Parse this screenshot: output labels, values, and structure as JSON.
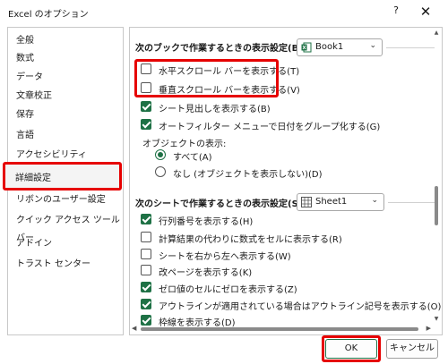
{
  "window": {
    "title": "Excel のオプション",
    "help_label": "?",
    "close_label": "✕"
  },
  "sidebar": {
    "items": [
      {
        "label": "全般"
      },
      {
        "label": "数式"
      },
      {
        "label": "データ"
      },
      {
        "label": "文章校正"
      },
      {
        "label": "保存"
      },
      {
        "label": "言語"
      },
      {
        "label": "アクセシビリティ"
      },
      {
        "label": "詳細設定",
        "selected": true
      },
      {
        "label": "リボンのユーザー設定"
      },
      {
        "label": "クイック アクセス ツール バー"
      },
      {
        "label": "アドイン"
      },
      {
        "label": "トラスト センター"
      }
    ]
  },
  "workbook_section": {
    "header": "次のブックで作業するときの表示設定(B):",
    "combo_value": "Book1",
    "options": [
      {
        "label": "水平スクロール バーを表示する(T)",
        "checked": false
      },
      {
        "label": "垂直スクロール バーを表示する(V)",
        "checked": false
      },
      {
        "label": "シート見出しを表示する(B)",
        "checked": true
      },
      {
        "label": "オートフィルター メニューで日付をグループ化する(G)",
        "checked": true
      }
    ],
    "objects_label": "オブジェクトの表示:",
    "radios": [
      {
        "label": "すべて(A)",
        "checked": true
      },
      {
        "label": "なし (オブジェクトを表示しない)(D)",
        "checked": false
      }
    ]
  },
  "sheet_section": {
    "header": "次のシートで作業するときの表示設定(S):",
    "combo_value": "Sheet1",
    "options": [
      {
        "label": "行列番号を表示する(H)",
        "checked": true
      },
      {
        "label": "計算結果の代わりに数式をセルに表示する(R)",
        "checked": false
      },
      {
        "label": "シートを右から左へ表示する(W)",
        "checked": false
      },
      {
        "label": "改ページを表示する(K)",
        "checked": false
      },
      {
        "label": "ゼロ値のセルにゼロを表示する(Z)",
        "checked": true
      },
      {
        "label": "アウトラインが適用されている場合はアウトライン記号を表示する(O)",
        "checked": true
      },
      {
        "label": "枠線を表示する(D)",
        "checked": true
      }
    ]
  },
  "footer": {
    "ok_label": "OK",
    "cancel_label": "キャンセル"
  },
  "colors": {
    "accent": "#1e7145",
    "highlight": "#e60000"
  }
}
